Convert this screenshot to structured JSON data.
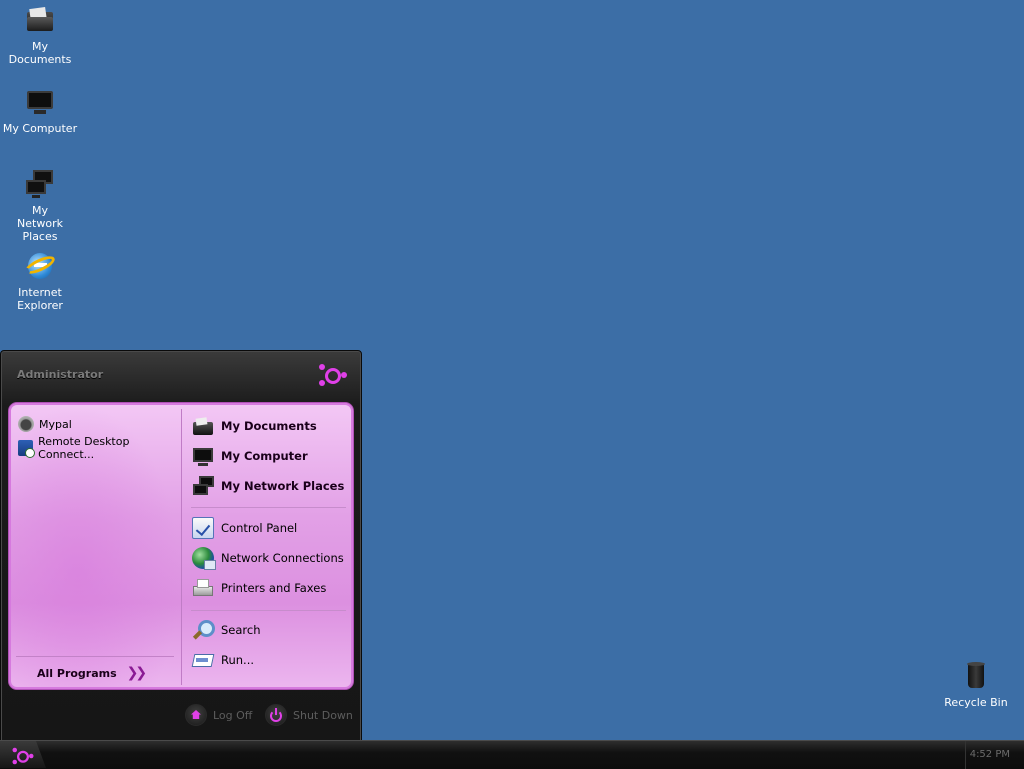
{
  "desktop": {
    "icons": [
      {
        "label": "My Documents",
        "icon": "folder-icon"
      },
      {
        "label": "My Computer",
        "icon": "monitor-icon"
      },
      {
        "label": "My Network Places",
        "icon": "network-icon"
      },
      {
        "label": "Internet Explorer",
        "icon": "ie-icon"
      },
      {
        "label": "Recycle Bin",
        "icon": "trash-icon"
      }
    ]
  },
  "start_menu": {
    "user": "Administrator",
    "pinned": [
      {
        "label": "Mypal",
        "icon": "mypal-icon"
      },
      {
        "label": "Remote Desktop Connect...",
        "icon": "remote-desktop-icon"
      }
    ],
    "all_programs": "All Programs",
    "right": [
      {
        "label": "My Documents",
        "icon": "folder-icon"
      },
      {
        "label": "My Computer",
        "icon": "monitor-icon"
      },
      {
        "label": "My Network Places",
        "icon": "network-icon"
      },
      {
        "label": "Control Panel",
        "icon": "control-panel-icon"
      },
      {
        "label": "Network Connections",
        "icon": "globe-icon"
      },
      {
        "label": "Printers and Faxes",
        "icon": "printer-icon"
      },
      {
        "label": "Search",
        "icon": "search-icon"
      },
      {
        "label": "Run...",
        "icon": "run-icon"
      }
    ],
    "log_off": "Log Off",
    "shut_down": "Shut Down"
  },
  "taskbar": {
    "clock": "4:52 PM"
  },
  "colors": {
    "desktop_bg": "#3c6ea6",
    "accent": "#e040e8",
    "menu_panel": "#e2a0e6"
  }
}
